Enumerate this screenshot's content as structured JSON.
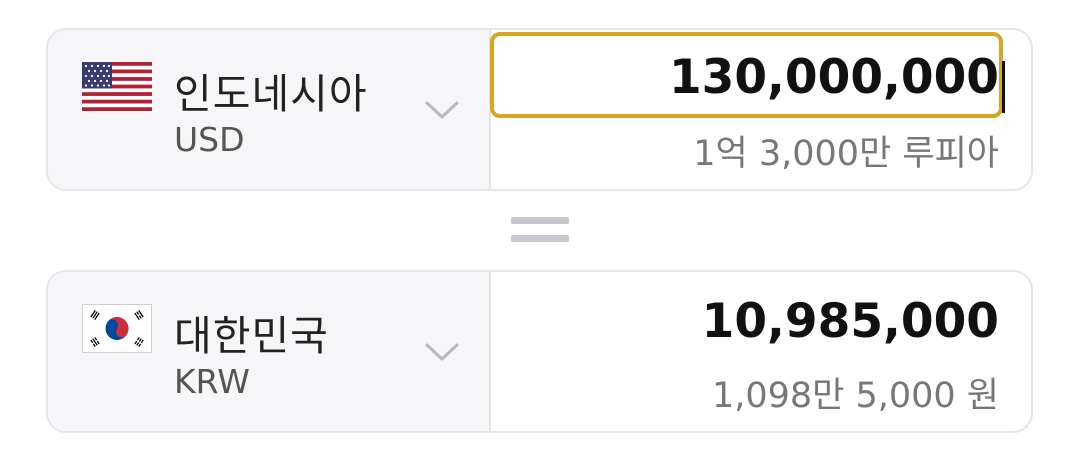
{
  "from": {
    "flag_icon": "us-flag-icon",
    "country": "인도네시아",
    "currency_code": "USD",
    "amount": "130,000,000",
    "amount_words": "1억 3,000만 루피아",
    "selector_icon": "chevron-down-icon"
  },
  "equals_icon": "equals-icon",
  "to": {
    "flag_icon": "kr-flag-icon",
    "country": "대한민국",
    "currency_code": "KRW",
    "amount": "10,985,000",
    "amount_words": "1,098만 5,000 원",
    "selector_icon": "chevron-down-icon"
  },
  "colors": {
    "accent_border": "#d9a420",
    "card_left_bg": "#f6f6f9",
    "equals_color": "#c7c7cd"
  }
}
